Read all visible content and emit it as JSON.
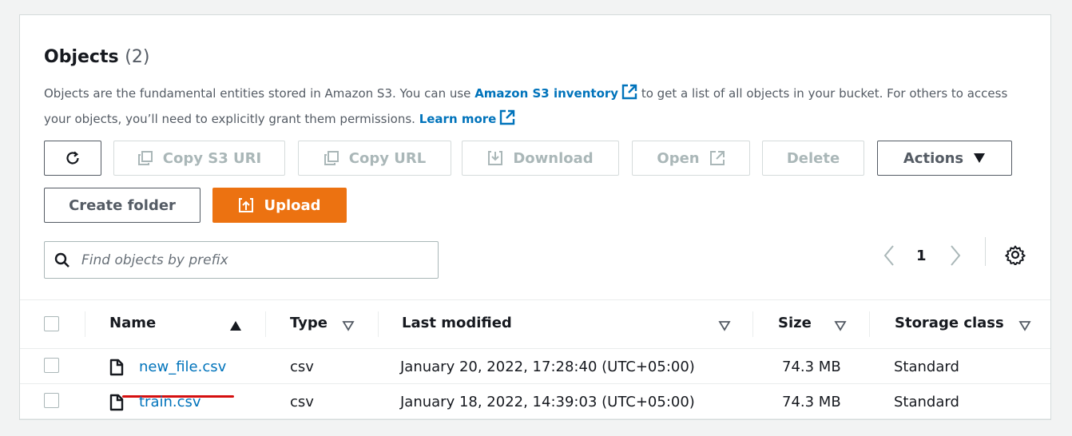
{
  "header": {
    "title": "Objects",
    "count": "(2)"
  },
  "description": {
    "part1": "Objects are the fundamental entities stored in Amazon S3. You can use ",
    "link1": "Amazon S3 inventory",
    "part2": " to get a list of all objects in your bucket. For others to access your objects, you’ll need to explicitly grant them permissions. ",
    "link2": "Learn more"
  },
  "toolbar": {
    "copy_s3_uri": "Copy S3 URI",
    "copy_url": "Copy URL",
    "download": "Download",
    "open": "Open",
    "delete": "Delete",
    "actions": "Actions",
    "create_folder": "Create folder",
    "upload": "Upload"
  },
  "search": {
    "placeholder": "Find objects by prefix",
    "value": ""
  },
  "pagination": {
    "page": "1"
  },
  "table": {
    "columns": [
      "Name",
      "Type",
      "Last modified",
      "Size",
      "Storage class"
    ],
    "rows": [
      {
        "name": "new_file.csv",
        "type": "csv",
        "last_modified": "January 20, 2022, 17:28:40 (UTC+05:00)",
        "size": "74.3 MB",
        "storage_class": "Standard"
      },
      {
        "name": "train.csv",
        "type": "csv",
        "last_modified": "January 18, 2022, 14:39:03 (UTC+05:00)",
        "size": "74.3 MB",
        "storage_class": "Standard"
      }
    ]
  },
  "icons": [
    "refresh-icon",
    "copy-icon",
    "download-icon",
    "external-link-icon",
    "caret-down-icon",
    "upload-icon",
    "search-icon",
    "chevron-left-icon",
    "chevron-right-icon",
    "gear-icon",
    "file-icon",
    "sort-ascending-icon",
    "sort-descending-icon"
  ],
  "colors": {
    "accent": "#ec7211",
    "link": "#0073bb",
    "annotation": "#d50f0f"
  }
}
